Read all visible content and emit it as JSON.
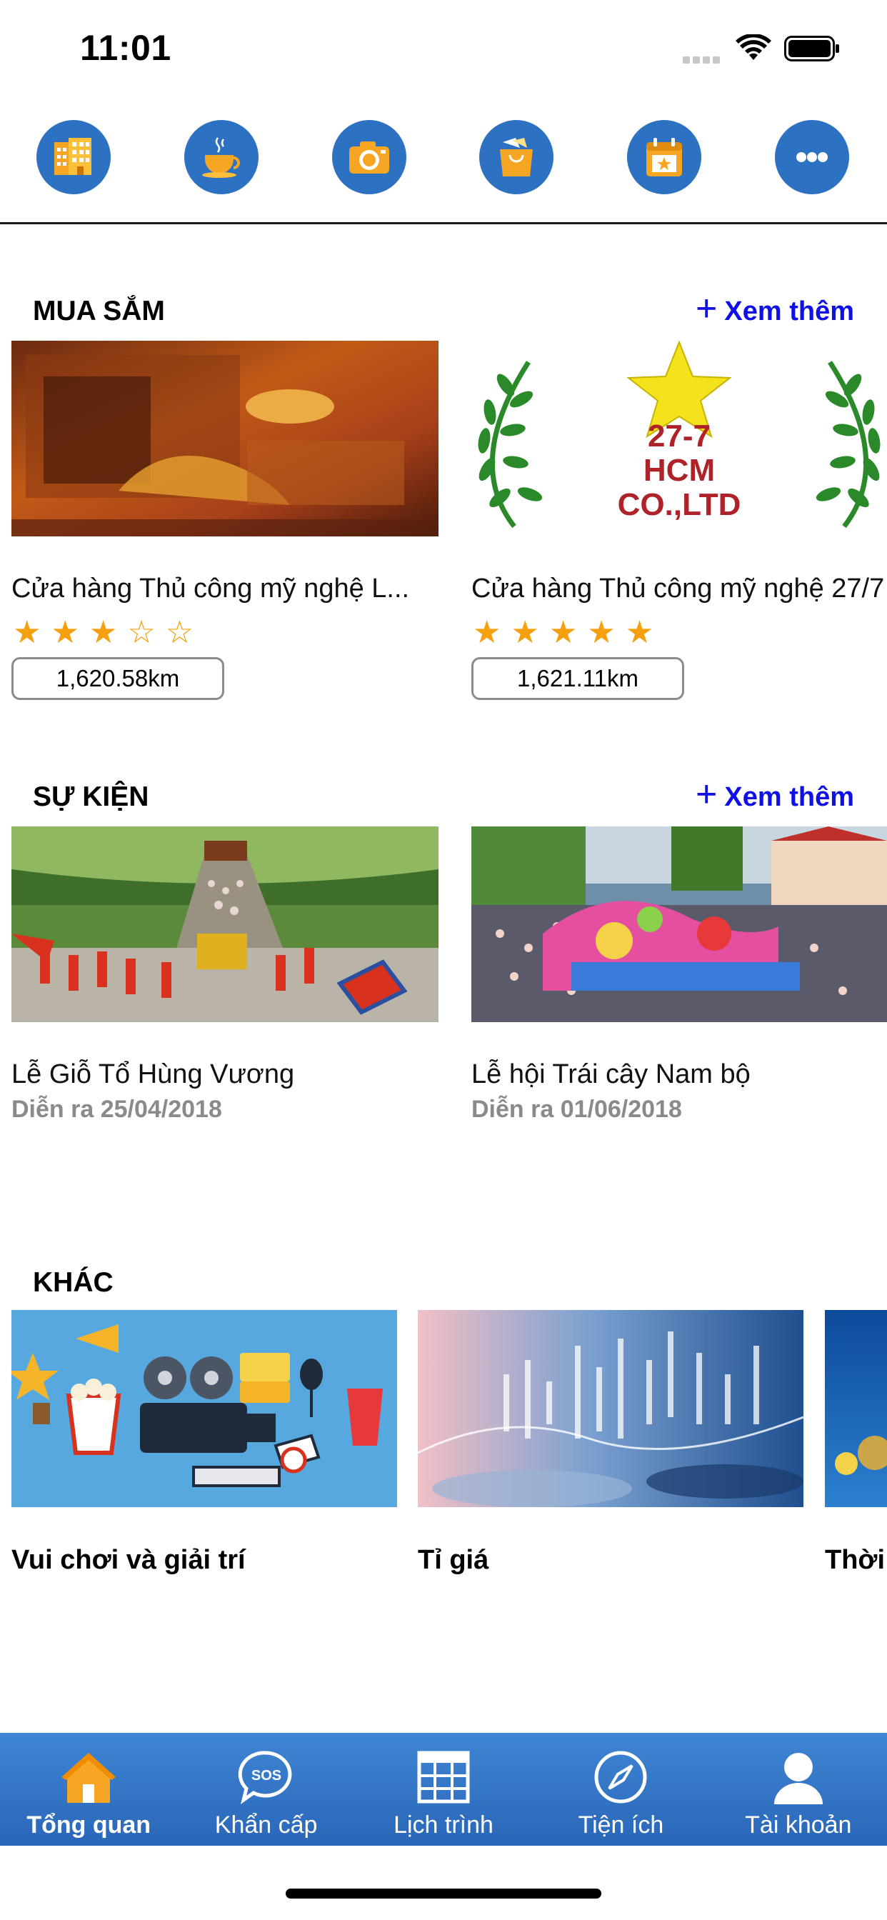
{
  "status_bar": {
    "time": "11:01"
  },
  "categories": [
    {
      "icon": "hotel-icon"
    },
    {
      "icon": "coffee-icon"
    },
    {
      "icon": "camera-icon"
    },
    {
      "icon": "shopping-bag-icon"
    },
    {
      "icon": "calendar-icon"
    },
    {
      "icon": "more-icon"
    }
  ],
  "shopping": {
    "title": "MUA SẮM",
    "see_more": "Xem thêm",
    "items": [
      {
        "name": "Cửa hàng Thủ công mỹ nghệ L...",
        "rating": 3,
        "distance": "1,620.58km"
      },
      {
        "name": "Cửa hàng Thủ công mỹ nghệ 27/7",
        "rating": 5,
        "distance": "1,621.11km",
        "logo_text": [
          "27-7",
          "HCM",
          "CO.,LTD"
        ]
      }
    ]
  },
  "events": {
    "title": "SỰ KIỆN",
    "see_more": "Xem thêm",
    "items": [
      {
        "name": "Lễ Giỗ Tổ Hùng Vương",
        "date": "Diễn ra 25/04/2018"
      },
      {
        "name": "Lễ hội Trái cây Nam bộ",
        "date": "Diễn ra 01/06/2018"
      }
    ]
  },
  "other": {
    "title": "KHÁC",
    "items": [
      {
        "name": "Vui chơi và giải trí"
      },
      {
        "name": "Tỉ giá"
      },
      {
        "name": "Thời"
      }
    ]
  },
  "tab_bar": {
    "tabs": [
      {
        "label": "Tổng quan",
        "icon": "home-icon",
        "active": true
      },
      {
        "label": "Khẩn cấp",
        "icon": "sos-icon",
        "active": false
      },
      {
        "label": "Lịch trình",
        "icon": "schedule-grid-icon",
        "active": false
      },
      {
        "label": "Tiện ích",
        "icon": "compass-icon",
        "active": false
      },
      {
        "label": "Tài khoản",
        "icon": "user-icon",
        "active": false
      }
    ]
  },
  "colors": {
    "accent": "#2d71c2",
    "link": "#1010e6",
    "star": "#f5a00f",
    "tab_bar": "#3479c9"
  }
}
